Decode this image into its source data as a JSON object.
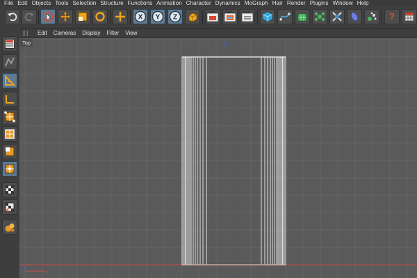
{
  "menu": {
    "items": [
      "File",
      "Edit",
      "Objects",
      "Tools",
      "Selection",
      "Structure",
      "Functions",
      "Animation",
      "Character",
      "Dynamics",
      "MoGraph",
      "Hair",
      "Render",
      "Plugins",
      "Window",
      "Help"
    ]
  },
  "toolbar": {
    "icons": [
      "undo-icon",
      "redo-icon",
      "live-select-icon",
      "move-icon",
      "scale-icon",
      "rotate-icon",
      "add-object-icon",
      "x-axis-lock-icon",
      "y-axis-lock-icon",
      "z-axis-lock-icon",
      "world-coordinates-icon",
      "render-view-icon",
      "render-picture-viewer-icon",
      "render-settings-icon",
      "cube-primitive-icon",
      "spline-pen-icon",
      "subdivision-surface-icon",
      "cloner-icon",
      "deformer-icon",
      "environment-icon",
      "scene-objects-icon",
      "camera-icon",
      "light-icon"
    ],
    "axis_x": "X",
    "axis_y": "Y",
    "axis_z": "Z"
  },
  "sidebar": {
    "icons": [
      "viewport-layout-icon",
      "texture-mode-icon",
      "model-mode-icon",
      "axis-mode-icon",
      "points-mode-icon",
      "edges-mode-icon",
      "polygons-mode-icon",
      "uv-mode-icon",
      "enable-axis-icon",
      "snap-icon",
      "workplane-icon",
      "sculpt-icon"
    ]
  },
  "viewport": {
    "menu": [
      "Edit",
      "Cameras",
      "Display",
      "Filter",
      "View"
    ],
    "label": "Top",
    "axis_vertical": "Z",
    "corner_z": "z",
    "corner_x": "x"
  },
  "colors": {
    "accent_active": "#5f7a91",
    "axis_x": "#cf4f4f",
    "axis_z": "#4f5fcf",
    "grid": "#646464",
    "viewport_bg": "#5a5a5a",
    "object_wire": "#e0e0e0"
  }
}
